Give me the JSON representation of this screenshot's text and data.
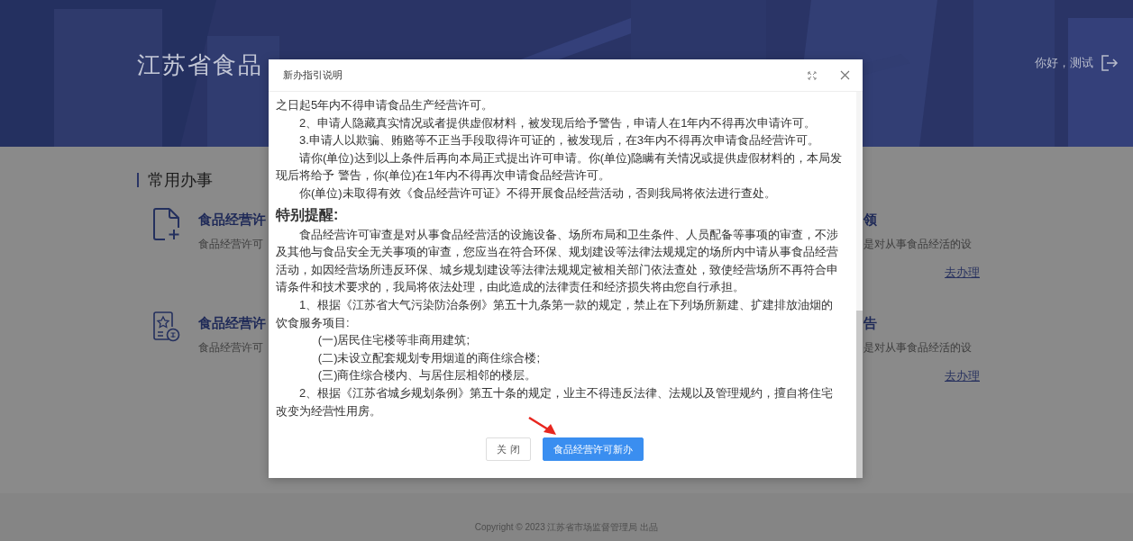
{
  "header": {
    "title": "江苏省食品",
    "greeting": "你好，测试"
  },
  "section": {
    "title": "常用办事"
  },
  "services_left": [
    {
      "kind": "file-add",
      "title": "食品经营许",
      "description": "食品经营许可"
    },
    {
      "kind": "certificate",
      "title": "食品经营许",
      "description": "食品经营许可"
    }
  ],
  "services_right": [
    {
      "title": "领",
      "description": "是对从事食品经活的设",
      "action": "去办理"
    },
    {
      "title": "告",
      "description": "是对从事食品经活的设",
      "action": "去办理"
    }
  ],
  "modal": {
    "title": "新办指引说明",
    "paragraphs": [
      {
        "kind": "continuation",
        "text": "之日起5年内不得申请食品生产经营许可。"
      },
      {
        "kind": "text",
        "text": "2、申请人隐藏真实情况或者提供虚假材料，被发现后给予警告，申请人在1年内不得再次申请许可。"
      },
      {
        "kind": "text",
        "text": "3.申请人以欺骗、贿赂等不正当手段取得许可证的，被发现后，在3年内不得再次申请食品经营许可。"
      },
      {
        "kind": "text",
        "text": "请你(单位)达到以上条件后再向本局正式提出许可申请。你(单位)隐瞒有关情况或提供虚假材料的，本局发现后将给予 警告，你(单位)在1年内不得再次申请食品经营许可。"
      },
      {
        "kind": "text",
        "text": "你(单位)未取得有效《食品经营许可证》不得开展食品经营活动，否则我局将依法进行查处。"
      },
      {
        "kind": "heading",
        "text": "特别提醒:"
      },
      {
        "kind": "text",
        "text": "食品经营许可审查是对从事食品经营活的设施设备、场所布局和卫生条件、人员配备等事项的审查，不涉及其他与食品安全无关事项的审查，您应当在符合环保、规划建设等法律法规规定的场所内中请从事食品经营活动，如因经营场所违反环保、城乡规划建设等法律法规规定被相关部门依法查处，致使经营场所不再符合申请条件和技术要求的，我局将依法处理，由此造成的法律责任和经济损失将由您自行承担。"
      },
      {
        "kind": "text",
        "text": "1、根据《江苏省大气污染防治条例》第五十九条第一款的规定，禁止在下列场所新建、扩建排放油烟的饮食服务项目:"
      },
      {
        "kind": "item",
        "text": "(一)居民住宅楼等非商用建筑;"
      },
      {
        "kind": "item",
        "text": "(二)未设立配套规划专用烟道的商住综合楼;"
      },
      {
        "kind": "item",
        "text": "(三)商住综合楼内、与居住层相邻的楼层。"
      },
      {
        "kind": "text",
        "text": "2、根据《江苏省城乡规划条例》第五十条的规定，业主不得违反法律、法规以及管理规约，擅自将住宅改变为经营性用房。"
      }
    ],
    "buttons": [
      {
        "kind": "secondary",
        "label": "关 闭"
      },
      {
        "kind": "primary",
        "label": "食品经营许可新办"
      }
    ]
  },
  "footer": {
    "copyright": "Copyright © 2023 江苏省市场监督管理局 出品"
  }
}
